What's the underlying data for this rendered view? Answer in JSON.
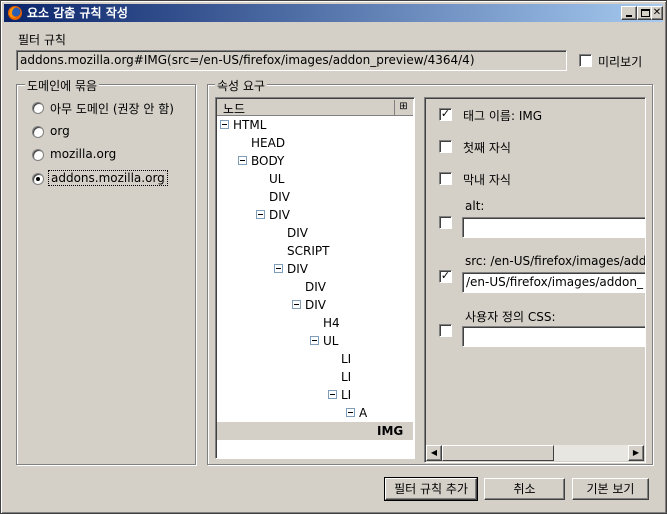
{
  "window": {
    "title": "요소 감춤 규칙 작성"
  },
  "filter": {
    "label": "필터 규칙",
    "value": "addons.mozilla.org#IMG(src=/en-US/firefox/images/addon_preview/4364/4)",
    "preview_label": "미리보기",
    "preview_checked": false
  },
  "domain_group": {
    "title": "도메인에 묶음",
    "options": [
      {
        "label": "아무 도메인 (권장 안 함)",
        "selected": false
      },
      {
        "label": "org",
        "selected": false
      },
      {
        "label": "mozilla.org",
        "selected": false
      },
      {
        "label": "addons.mozilla.org",
        "selected": true
      }
    ]
  },
  "attr_group": {
    "title": "속성 요구",
    "tree_header": "노드",
    "tree": [
      {
        "label": "HTML",
        "depth": 0,
        "twisty": true
      },
      {
        "label": "HEAD",
        "depth": 1,
        "twisty": false
      },
      {
        "label": "BODY",
        "depth": 1,
        "twisty": true
      },
      {
        "label": "UL",
        "depth": 2,
        "twisty": false
      },
      {
        "label": "DIV",
        "depth": 2,
        "twisty": false
      },
      {
        "label": "DIV",
        "depth": 2,
        "twisty": true
      },
      {
        "label": "DIV",
        "depth": 3,
        "twisty": false
      },
      {
        "label": "SCRIPT",
        "depth": 3,
        "twisty": false
      },
      {
        "label": "DIV",
        "depth": 3,
        "twisty": true
      },
      {
        "label": "DIV",
        "depth": 4,
        "twisty": false
      },
      {
        "label": "DIV",
        "depth": 4,
        "twisty": true
      },
      {
        "label": "H4",
        "depth": 5,
        "twisty": false
      },
      {
        "label": "UL",
        "depth": 5,
        "twisty": true
      },
      {
        "label": "LI",
        "depth": 6,
        "twisty": false
      },
      {
        "label": "LI",
        "depth": 6,
        "twisty": false
      },
      {
        "label": "LI",
        "depth": 6,
        "twisty": true
      },
      {
        "label": "A",
        "depth": 7,
        "twisty": true
      },
      {
        "label": "IMG",
        "depth": 8,
        "twisty": false,
        "selected": true
      }
    ],
    "tag_name_label": "태그 이름: IMG",
    "tag_name_checked": true,
    "first_child_label": "첫째 자식",
    "first_child_checked": false,
    "last_child_label": "막내 자식",
    "last_child_checked": false,
    "alt_label": "alt:",
    "alt_checked": false,
    "alt_value": "",
    "src_label": "src: /en-US/firefox/images/addo",
    "src_checked": true,
    "src_value": "/en-US/firefox/images/addon_",
    "css_label": "사용자 정의 CSS:",
    "css_checked": false,
    "css_value": ""
  },
  "buttons": {
    "add_filter": "필터 규칙 추가",
    "cancel": "취소",
    "basic_view": "기본 보기"
  },
  "colors": {
    "titlebar_start": "#0a246a",
    "titlebar_end": "#a6caf0",
    "dialog_bg": "#d4d0c8",
    "selection_bg": "#d4d0c8"
  }
}
